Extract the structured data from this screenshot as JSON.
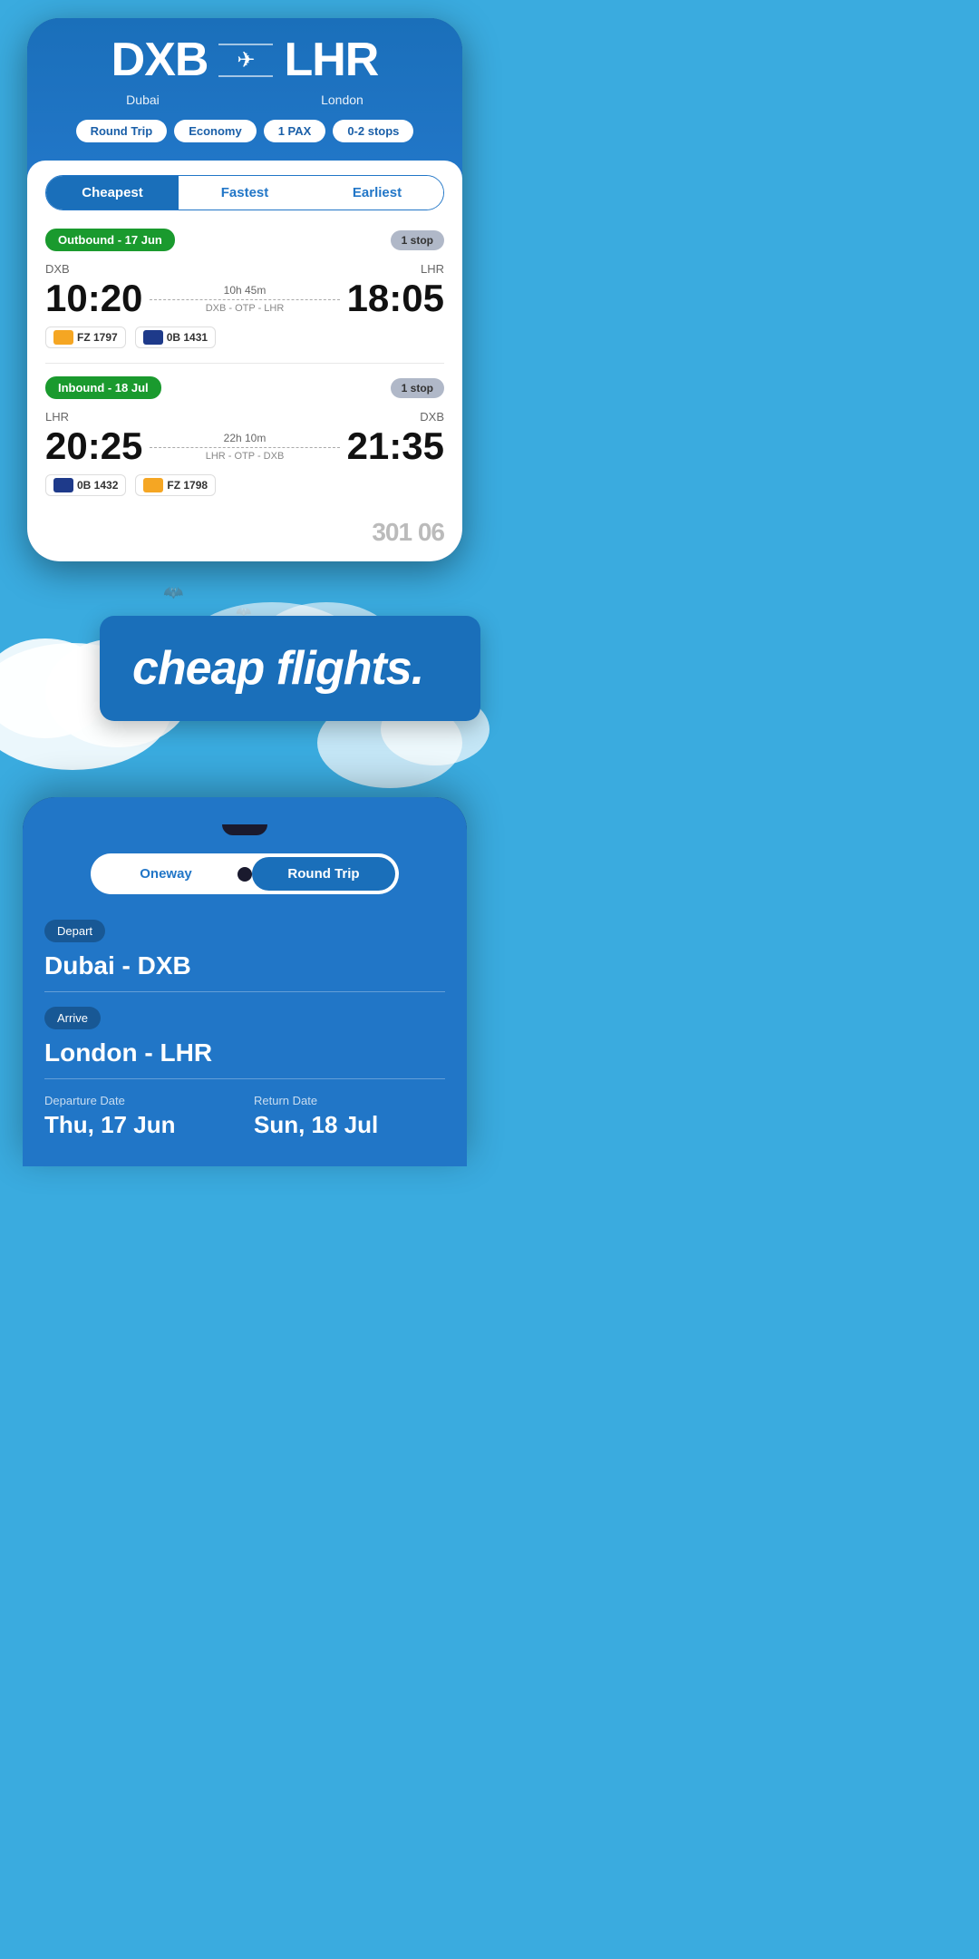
{
  "top_phone": {
    "origin": {
      "code": "DXB",
      "city": "Dubai"
    },
    "destination": {
      "code": "LHR",
      "city": "London"
    },
    "pills": {
      "trip_type": "Round Trip",
      "cabin": "Economy",
      "pax": "1 PAX",
      "stops": "0-2 stops"
    },
    "tabs": {
      "cheapest": "Cheapest",
      "fastest": "Fastest",
      "earliest": "Earliest",
      "active": "cheapest"
    },
    "outbound": {
      "label": "Outbound - 17 Jun",
      "stop_label": "1 stop",
      "origin_code": "DXB",
      "dest_code": "LHR",
      "dep_time": "10:20",
      "arr_time": "18:05",
      "duration": "10h 45m",
      "via": "DXB - OTP - LHR",
      "airlines": [
        {
          "code": "FZ 1797",
          "logo_type": "flydubai"
        },
        {
          "code": "0B 1431",
          "logo_type": "blueair"
        }
      ]
    },
    "inbound": {
      "label": "Inbound - 18 Jul",
      "stop_label": "1 stop",
      "origin_code": "LHR",
      "dest_code": "DXB",
      "dep_time": "20:25",
      "arr_time": "21:35",
      "duration": "22h 10m",
      "via": "LHR - OTP - DXB",
      "airlines": [
        {
          "code": "0B 1432",
          "logo_type": "blueair"
        },
        {
          "code": "FZ 1798",
          "logo_type": "flydubai"
        }
      ]
    }
  },
  "middle_banner": {
    "text": "cheap flights."
  },
  "bottom_phone": {
    "trip_options": {
      "oneway": "Oneway",
      "round_trip": "Round Trip",
      "active": "round_trip"
    },
    "depart_label": "Depart",
    "depart_value": "Dubai - DXB",
    "arrive_label": "Arrive",
    "arrive_value": "London - LHR",
    "departure_date_label": "Departure Date",
    "departure_date_value": "Thu, 17 Jun",
    "return_date_label": "Return Date",
    "return_date_value": "Sun, 18 Jul"
  }
}
